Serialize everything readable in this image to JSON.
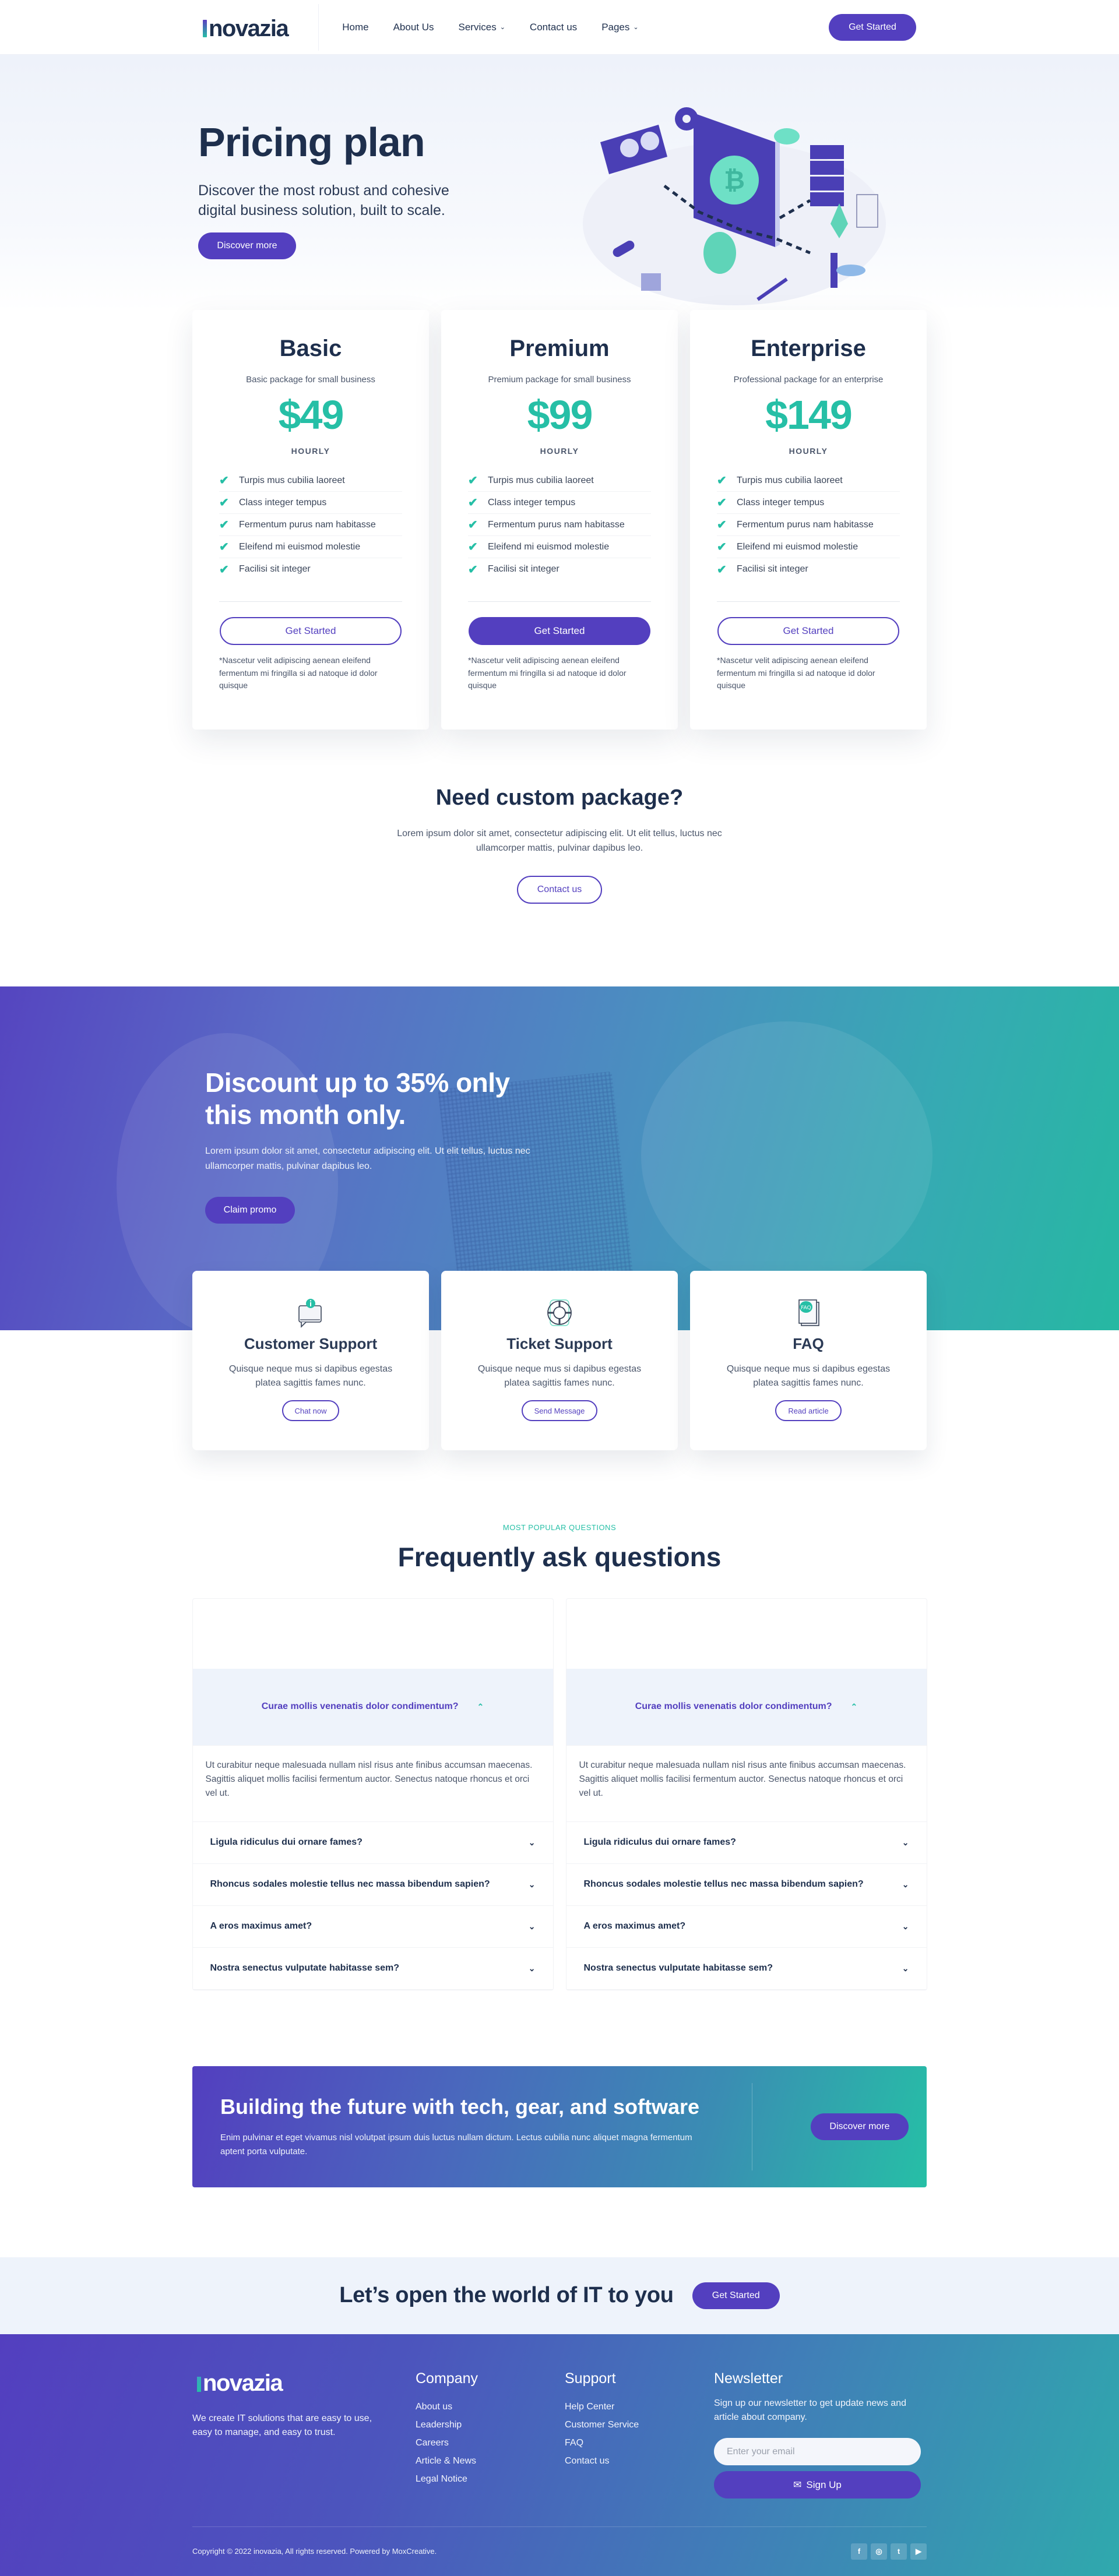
{
  "brand": {
    "name": "novazia",
    "prefix": "I",
    "accent": "#533fbf",
    "secondary": "#26bfa6",
    "heading_color": "#1e2f4d"
  },
  "nav": {
    "items": [
      {
        "label": "Home",
        "dropdown": false
      },
      {
        "label": "About Us",
        "dropdown": false
      },
      {
        "label": "Services",
        "dropdown": true
      },
      {
        "label": "Contact us",
        "dropdown": false
      },
      {
        "label": "Pages",
        "dropdown": true
      }
    ],
    "cta_label": "Get Started"
  },
  "hero": {
    "title": "Pricing plan",
    "subtitle": "Discover the most robust and cohesive digital business solution, built to scale.",
    "button_label": "Discover more",
    "illustration": "isometric-crypto-mining-illustration"
  },
  "pricing": {
    "plans": [
      {
        "name": "Basic",
        "description": "Basic package for small business",
        "price": "$49",
        "period": "HOURLY",
        "features": [
          "Turpis mus cubilia laoreet",
          "Class integer tempus",
          "Fermentum purus nam habitasse",
          "Eleifend mi euismod molestie",
          "Facilisi sit integer"
        ],
        "button_label": "Get Started",
        "highlighted": false,
        "note": "*Nascetur velit adipiscing aenean eleifend fermentum mi fringilla si ad natoque id dolor quisque"
      },
      {
        "name": "Premium",
        "description": "Premium package for small business",
        "price": "$99",
        "period": "HOURLY",
        "features": [
          "Turpis mus cubilia laoreet",
          "Class integer tempus",
          "Fermentum purus nam habitasse",
          "Eleifend mi euismod molestie",
          "Facilisi sit integer"
        ],
        "button_label": "Get Started",
        "highlighted": true,
        "note": "*Nascetur velit adipiscing aenean eleifend fermentum mi fringilla si ad natoque id dolor quisque"
      },
      {
        "name": "Enterprise",
        "description": "Professional package for an enterprise",
        "price": "$149",
        "period": "HOURLY",
        "features": [
          "Turpis mus cubilia laoreet",
          "Class integer tempus",
          "Fermentum purus nam habitasse",
          "Eleifend mi euismod molestie",
          "Facilisi sit integer"
        ],
        "button_label": "Get Started",
        "highlighted": false,
        "note": "*Nascetur velit adipiscing aenean eleifend fermentum mi fringilla si ad natoque id dolor quisque"
      }
    ]
  },
  "custom_package": {
    "title": "Need custom package?",
    "text": "Lorem ipsum dolor sit amet, consectetur adipiscing elit. Ut elit tellus, luctus nec ullamcorper mattis, pulvinar dapibus leo.",
    "button_label": "Contact us"
  },
  "discount": {
    "title": "Discount up to 35% only this month only.",
    "text": "Lorem ipsum dolor sit amet, consectetur adipiscing elit. Ut elit tellus, luctus nec ullamcorper mattis, pulvinar dapibus leo.",
    "button_label": "Claim promo"
  },
  "support": {
    "cards": [
      {
        "icon": "chat-info-icon",
        "title": "Customer Support",
        "text": "Quisque neque mus si dapibus egestas platea sagittis fames nunc.",
        "button_label": "Chat now"
      },
      {
        "icon": "lifebuoy-icon",
        "title": "Ticket Support",
        "text": "Quisque neque mus si dapibus egestas platea sagittis fames nunc.",
        "button_label": "Send Message"
      },
      {
        "icon": "faq-document-icon",
        "title": "FAQ",
        "text": "Quisque neque mus si dapibus egestas platea sagittis fames nunc.",
        "button_label": "Read article"
      }
    ]
  },
  "faq": {
    "kicker": "MOST POPULAR QUESTIONS",
    "title": "Frequently ask questions",
    "columns": [
      [
        {
          "q": "Curae mollis venenatis dolor condimentum?",
          "a": "Ut curabitur neque malesuada nullam nisl risus ante finibus accumsan maecenas. Sagittis aliquet mollis facilisi fermentum auctor. Senectus natoque rhoncus et orci vel ut.",
          "open": true
        },
        {
          "q": "Ligula ridiculus dui ornare fames?",
          "open": false
        },
        {
          "q": "Rhoncus sodales molestie tellus nec massa bibendum sapien?",
          "open": false
        },
        {
          "q": "A eros maximus amet?",
          "open": false
        },
        {
          "q": "Nostra senectus vulputate habitasse sem?",
          "open": false
        }
      ],
      [
        {
          "q": "Curae mollis venenatis dolor condimentum?",
          "a": "Ut curabitur neque malesuada nullam nisl risus ante finibus accumsan maecenas. Sagittis aliquet mollis facilisi fermentum auctor. Senectus natoque rhoncus et orci vel ut.",
          "open": true
        },
        {
          "q": "Ligula ridiculus dui ornare fames?",
          "open": false
        },
        {
          "q": "Rhoncus sodales molestie tellus nec massa bibendum sapien?",
          "open": false
        },
        {
          "q": "A eros maximus amet?",
          "open": false
        },
        {
          "q": "Nostra senectus vulputate habitasse sem?",
          "open": false
        }
      ]
    ]
  },
  "cta_banner": {
    "title": "Building the future with tech, gear, and software",
    "text": "Enim pulvinar et eget vivamus nisl volutpat ipsum duis luctus nullam dictum. Lectus cubilia nunc aliquet magna fermentum aptent porta vulputate.",
    "button_label": "Discover more"
  },
  "open_world": {
    "title": "Let’s open the world of IT to you",
    "button_label": "Get Started"
  },
  "footer": {
    "tagline": "We create IT solutions that are easy to use, easy to manage, and easy to trust.",
    "company": {
      "title": "Company",
      "links": [
        "About us",
        "Leadership",
        "Careers",
        "Article & News",
        "Legal Notice"
      ]
    },
    "support": {
      "title": "Support",
      "links": [
        "Help Center",
        "Customer Service",
        "FAQ",
        "Contact us"
      ]
    },
    "newsletter": {
      "title": "Newsletter",
      "text": "Sign up our newsletter to get update news and article about company.",
      "email_placeholder": "Enter your email",
      "email_value": "",
      "button_label": "Sign Up"
    },
    "copyright": "Copyright © 2022 inovazia, All rights reserved. Powered by MoxCreative.",
    "socials": [
      {
        "name": "facebook-icon",
        "glyph": "f"
      },
      {
        "name": "instagram-icon",
        "glyph": "◎"
      },
      {
        "name": "twitter-icon",
        "glyph": "t"
      },
      {
        "name": "youtube-icon",
        "glyph": "▶"
      }
    ]
  }
}
